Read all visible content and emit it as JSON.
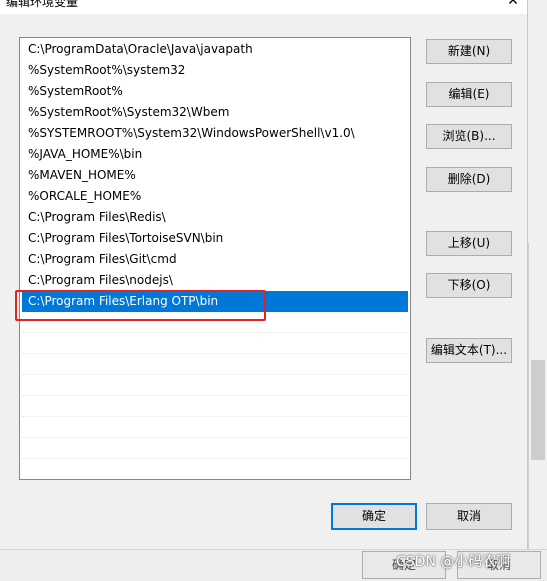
{
  "window": {
    "title": "编辑环境变量",
    "close_symbol": "✕"
  },
  "env_list": {
    "items": [
      "C:\\ProgramData\\Oracle\\Java\\javapath",
      "%SystemRoot%\\system32",
      "%SystemRoot%",
      "%SystemRoot%\\System32\\Wbem",
      "%SYSTEMROOT%\\System32\\WindowsPowerShell\\v1.0\\",
      "%JAVA_HOME%\\bin",
      "%MAVEN_HOME%",
      "%ORCALE_HOME%",
      "C:\\Program Files\\Redis\\",
      "C:\\Program Files\\TortoiseSVN\\bin",
      "C:\\Program Files\\Git\\cmd",
      "C:\\Program Files\\nodejs\\",
      "C:\\Program Files\\Erlang OTP\\bin"
    ],
    "selected_index": 12
  },
  "buttons": {
    "new": "新建(N)",
    "edit": "编辑(E)",
    "browse": "浏览(B)...",
    "delete": "删除(D)",
    "move_up": "上移(U)",
    "move_down": "下移(O)",
    "edit_text": "编辑文本(T)...",
    "ok": "确定",
    "cancel": "取消"
  },
  "background_window": {
    "ok": "确定",
    "cancel": "取消"
  },
  "watermark": "CSDN @小码农啊",
  "colors": {
    "selection": "#0078d7",
    "highlight_box": "#e02424"
  }
}
